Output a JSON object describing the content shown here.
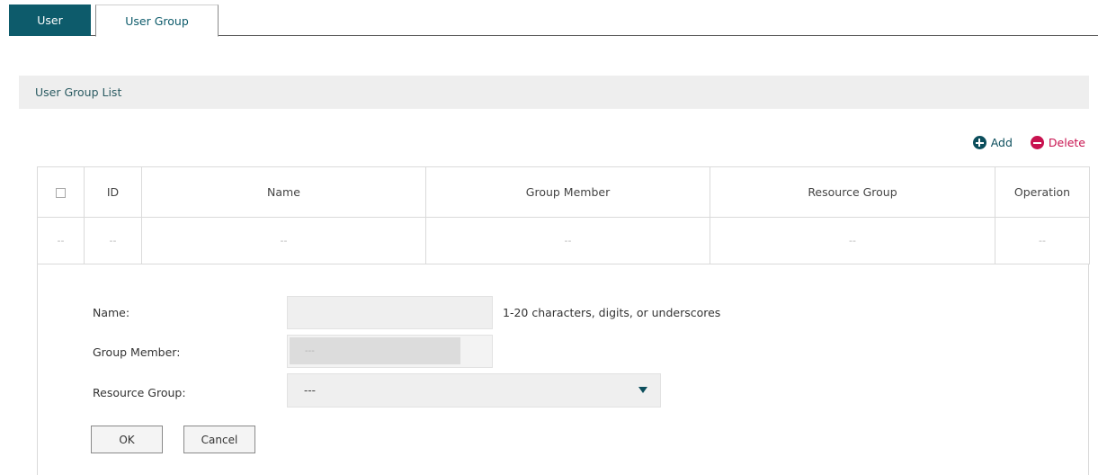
{
  "tabs": [
    {
      "label": "User",
      "active": false
    },
    {
      "label": "User Group",
      "active": true
    }
  ],
  "section": {
    "title": "User Group List"
  },
  "actions": {
    "add_label": "Add",
    "delete_label": "Delete"
  },
  "table": {
    "columns": [
      "ID",
      "Name",
      "Group Member",
      "Resource Group",
      "Operation"
    ],
    "rows": [
      {
        "select": "--",
        "id": "--",
        "name": "--",
        "group_member": "--",
        "resource_group": "--",
        "operation": "--"
      }
    ]
  },
  "form": {
    "name_label": "Name:",
    "name_value": "",
    "name_hint": "1-20 characters, digits, or underscores",
    "member_label": "Group Member:",
    "member_value": "---",
    "resource_label": "Resource Group:",
    "resource_value": "---",
    "ok_label": "OK",
    "cancel_label": "Cancel"
  },
  "colors": {
    "accent": "#0d5b6b",
    "add": "#0c4e5c",
    "delete": "#c8124f"
  },
  "icons": {
    "add": "plus-circle-icon",
    "delete": "minus-circle-icon",
    "dropdown": "caret-down-icon"
  }
}
